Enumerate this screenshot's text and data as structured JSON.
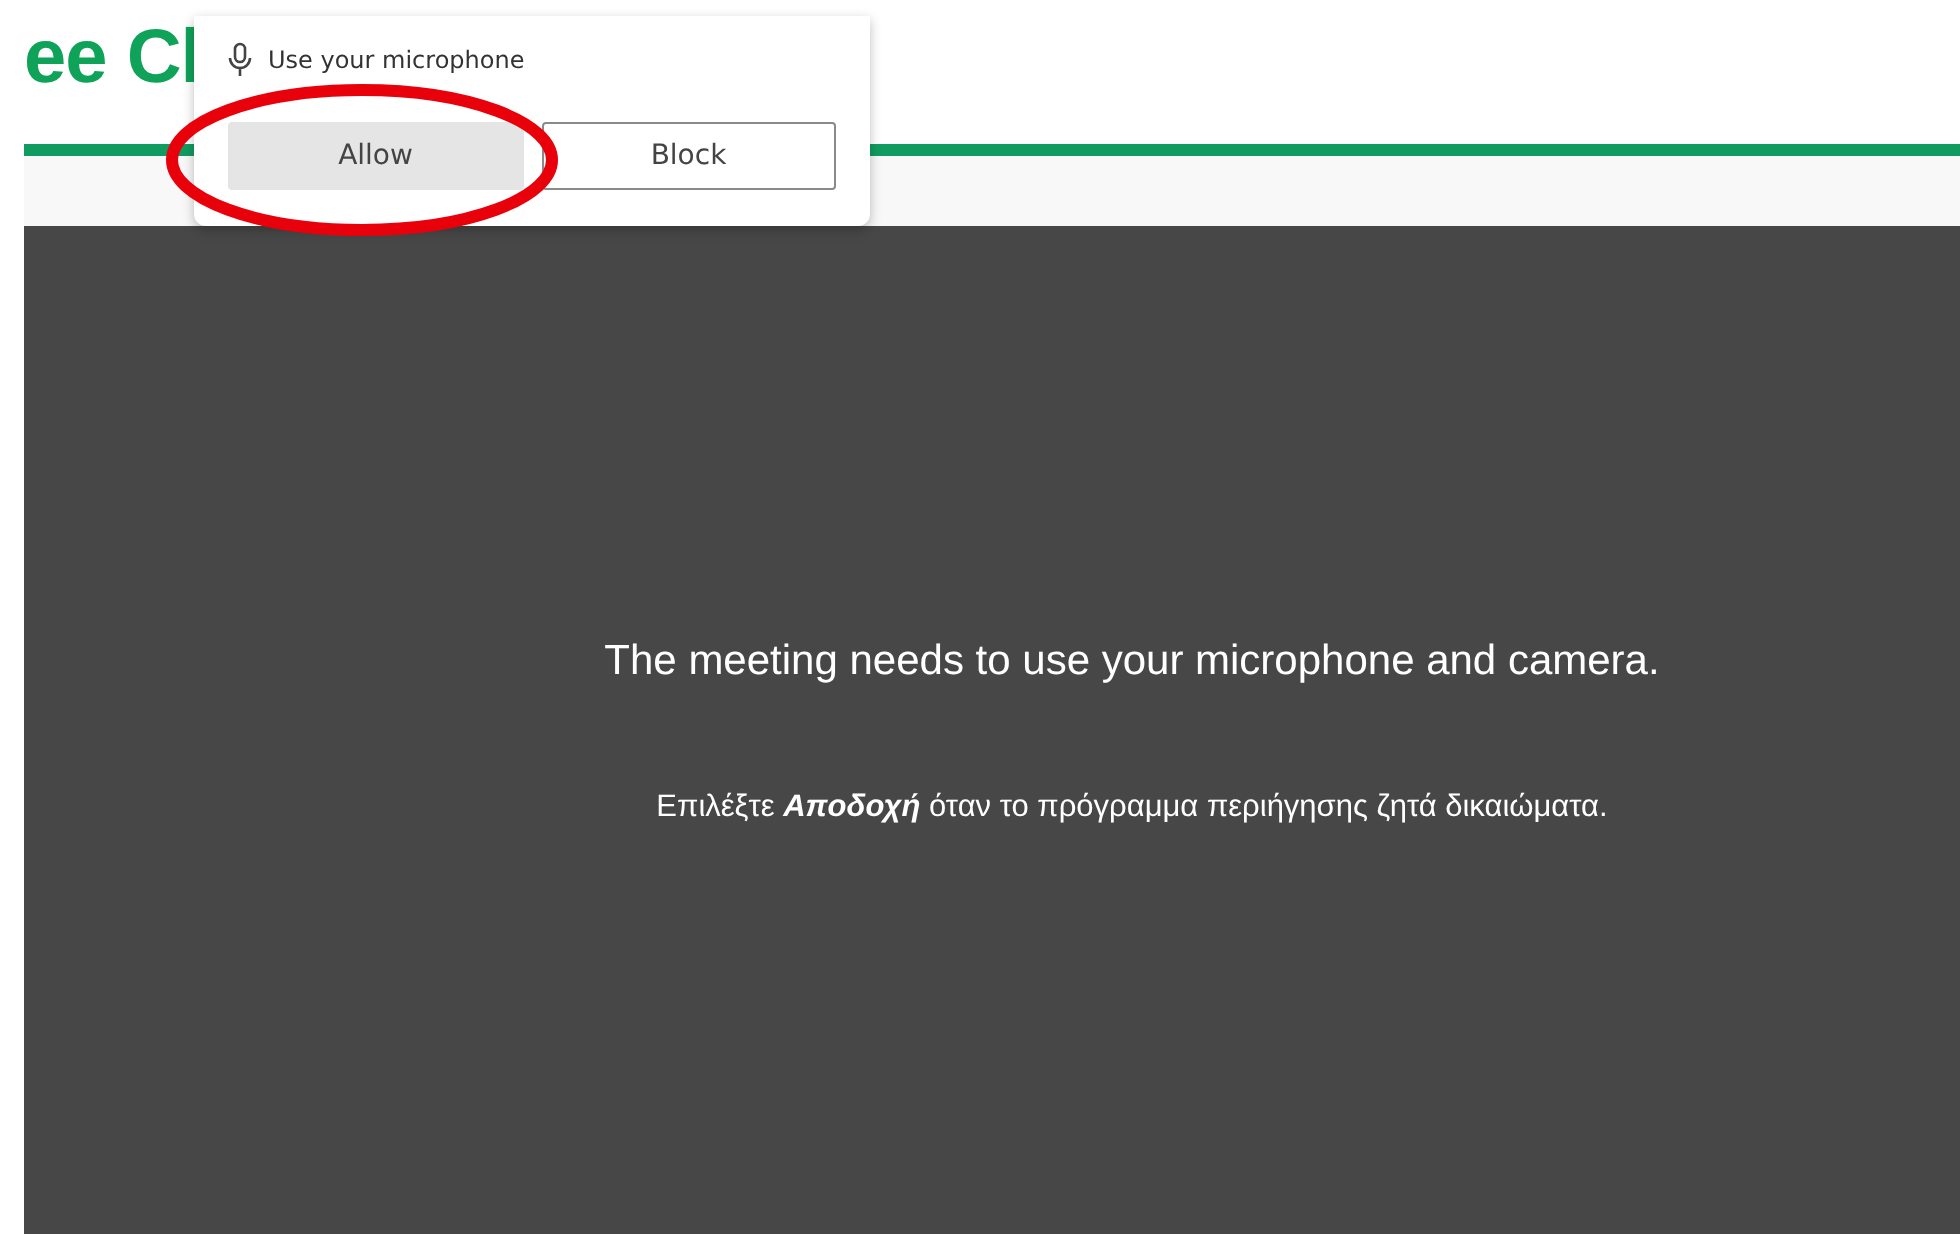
{
  "logo": {
    "text": "ee Cl"
  },
  "permission_prompt": {
    "title": "Use your microphone",
    "buttons": [
      {
        "label": "Allow",
        "selected": true
      },
      {
        "label": "Block",
        "selected": false
      }
    ]
  },
  "message": {
    "heading": "The meeting needs to use your microphone and camera.",
    "instruction": "Επιλέξτε **Αποδοχή** όταν το πρόγραμμα περιήγησης ζητά δικαιώματα."
  }
}
